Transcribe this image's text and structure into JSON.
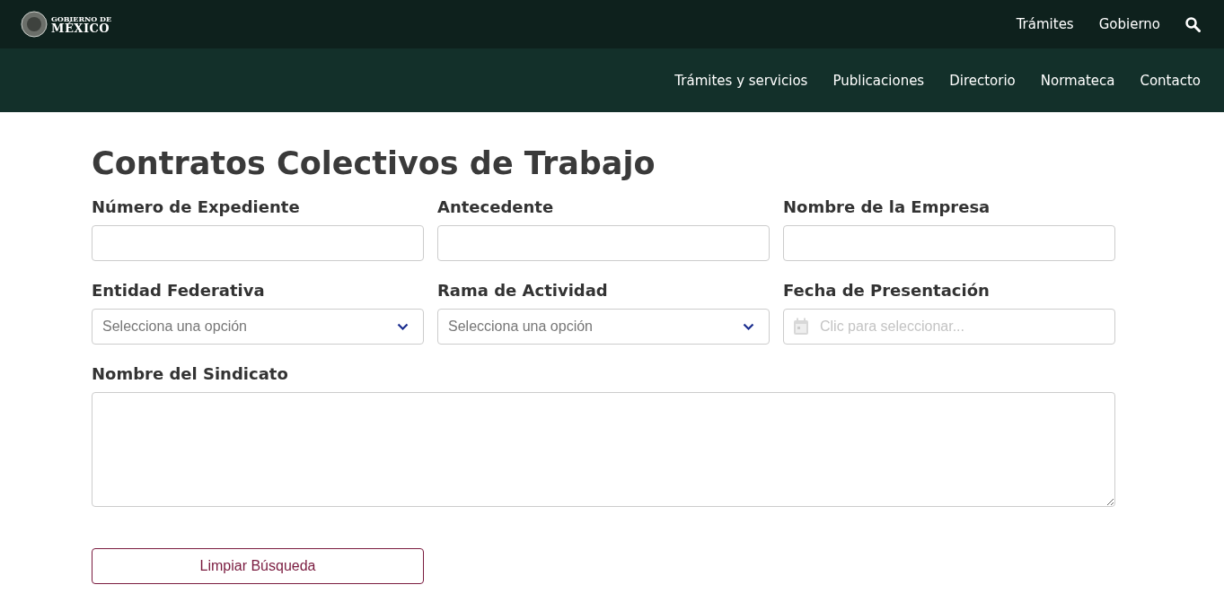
{
  "header": {
    "logo": {
      "line_1": "GOBIERNO DE",
      "line_2": "MÉXICO"
    },
    "links": [
      "Trámites",
      "Gobierno"
    ]
  },
  "nav": {
    "items": [
      "Trámites y servicios",
      "Publicaciones",
      "Directorio",
      "Normateca",
      "Contacto"
    ]
  },
  "title": "Contratos Colectivos de Trabajo",
  "fields": [
    {
      "label": "Número de Expediente",
      "kind": "text"
    },
    {
      "label": "Antecedente",
      "kind": "text"
    },
    {
      "label": "Nombre de la Empresa",
      "kind": "text"
    },
    {
      "label": "Entidad Federativa",
      "kind": "select",
      "placeholder": "Selecciona una opción"
    },
    {
      "label": "Rama de Actividad",
      "kind": "select",
      "placeholder": "Selecciona una opción"
    },
    {
      "label": "Fecha de Presentación",
      "kind": "date",
      "placeholder": "Clic para seleccionar..."
    },
    {
      "label": "Nombre del Sindicato",
      "kind": "textarea"
    }
  ],
  "buttons": [
    "Limpiar Búsqueda"
  ]
}
